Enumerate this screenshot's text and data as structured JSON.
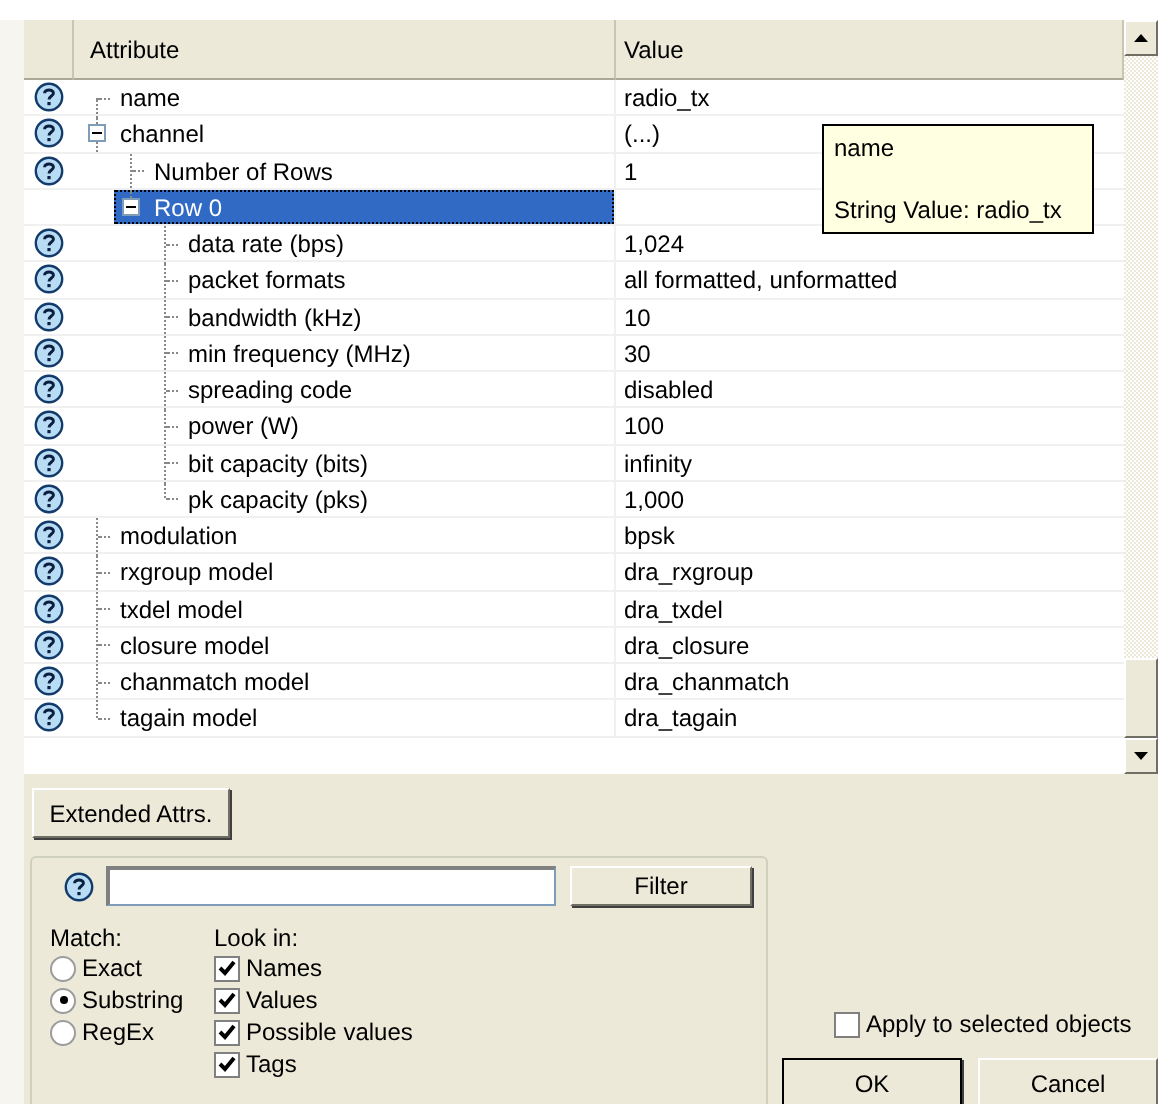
{
  "table": {
    "columns": [
      "Attribute",
      "Value"
    ],
    "rows": [
      {
        "name": "name",
        "value": "radio_tx",
        "help": true,
        "expanded": false,
        "selected": false
      },
      {
        "name": "channel",
        "value": "(...)",
        "help": true,
        "expanded": true,
        "selected": false,
        "children": [
          {
            "name": "Number of Rows",
            "value": "1",
            "help": true,
            "expanded": false,
            "selected": false
          },
          {
            "name": "Row 0",
            "help": false,
            "expanded": true,
            "selected": true,
            "children": [
              {
                "name": "data rate (bps)",
                "value": "1,024",
                "help": true,
                "expanded": false,
                "selected": false
              },
              {
                "name": "packet formats",
                "value": "all formatted, unformatted",
                "help": true,
                "expanded": false,
                "selected": false
              },
              {
                "name": "bandwidth (kHz)",
                "value": "10",
                "help": true,
                "expanded": false,
                "selected": false
              },
              {
                "name": "min frequency (MHz)",
                "value": "30",
                "help": true,
                "expanded": false,
                "selected": false
              },
              {
                "name": "spreading code",
                "value": "disabled",
                "help": true,
                "expanded": false,
                "selected": false
              },
              {
                "name": "power (W)",
                "value": "100",
                "help": true,
                "expanded": false,
                "selected": false
              },
              {
                "name": "bit capacity (bits)",
                "value": "infinity",
                "help": true,
                "expanded": false,
                "selected": false
              },
              {
                "name": "pk capacity (pks)",
                "value": "1,000",
                "help": true,
                "expanded": false,
                "selected": false
              }
            ]
          }
        ]
      },
      {
        "name": "modulation",
        "value": "bpsk",
        "help": true,
        "expanded": false,
        "selected": false
      },
      {
        "name": "rxgroup model",
        "value": "dra_rxgroup",
        "help": true,
        "expanded": false,
        "selected": false
      },
      {
        "name": "txdel model",
        "value": "dra_txdel",
        "help": true,
        "expanded": false,
        "selected": false
      },
      {
        "name": "closure model",
        "value": "dra_closure",
        "help": true,
        "expanded": false,
        "selected": false
      },
      {
        "name": "chanmatch model",
        "value": "dra_chanmatch",
        "help": true,
        "expanded": false,
        "selected": false
      },
      {
        "name": "tagain model",
        "value": "dra_tagain",
        "help": true,
        "expanded": false,
        "selected": false
      }
    ]
  },
  "tooltip": {
    "title": "name",
    "text": "String Value: radio_tx"
  },
  "extended_button": {
    "label": "Extended Attrs."
  },
  "filter": {
    "button": {
      "label": "Filter"
    },
    "match_label": "Match:",
    "match_options": [
      {
        "label": "Exact",
        "selected": false
      },
      {
        "label": "Substring",
        "selected": true
      },
      {
        "label": "RegEx",
        "selected": false
      }
    ],
    "look_in_label": "Look in:",
    "look_in_options": [
      {
        "label": "Names",
        "checked": true
      },
      {
        "label": "Values",
        "checked": true
      },
      {
        "label": "Possible values",
        "checked": true
      },
      {
        "label": "Tags",
        "checked": true
      }
    ]
  },
  "apply": {
    "label": "Apply to selected objects",
    "checked": false
  },
  "buttons": [
    {
      "label": "OK"
    },
    {
      "label": "Cancel"
    }
  ]
}
